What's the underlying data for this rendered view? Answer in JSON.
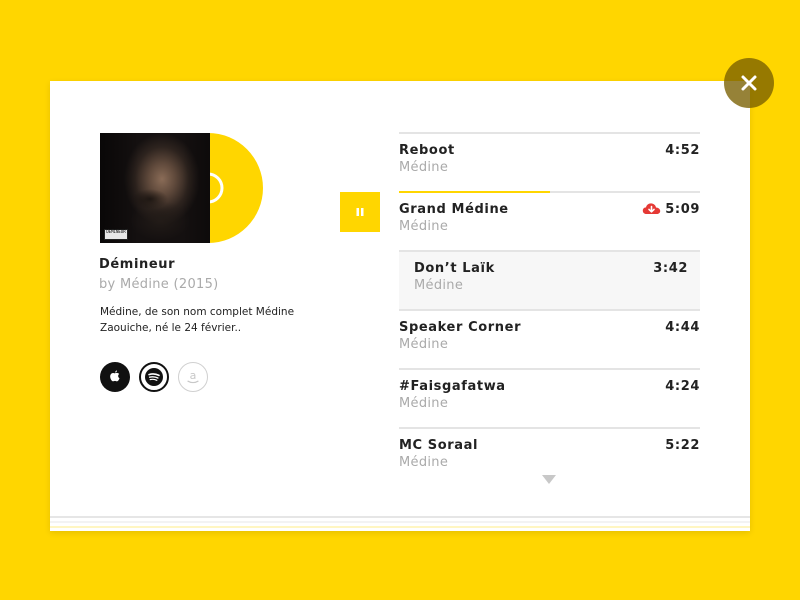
{
  "album": {
    "title": "Démineur",
    "byline": "by Médine (2015)",
    "description": "Médine, de son nom complet Médine Zaouiche, né le 24 février..",
    "cover_label": "DEMINEUR"
  },
  "stores": [
    {
      "name": "apple",
      "icon": "apple-icon"
    },
    {
      "name": "spotify",
      "icon": "spotify-icon"
    },
    {
      "name": "amazon",
      "icon": "amazon-icon",
      "glyph": "a"
    }
  ],
  "player": {
    "state": "playing",
    "current_track_progress": 0.5
  },
  "tracks": [
    {
      "title": "Reboot",
      "artist": "Médine",
      "duration": "4:52"
    },
    {
      "title": "Grand Médine",
      "artist": "Médine",
      "duration": "5:09",
      "cloud_icon": "cloud-download-icon"
    },
    {
      "title": "Don’t Laïk",
      "artist": "Médine",
      "duration": "3:42"
    },
    {
      "title": "Speaker Corner",
      "artist": "Médine",
      "duration": "4:44"
    },
    {
      "title": "#Faisgafatwa",
      "artist": "Médine",
      "duration": "4:24"
    },
    {
      "title": "MC Soraal",
      "artist": "Médine",
      "duration": "5:22"
    }
  ],
  "colors": {
    "accent": "#FFD600",
    "download": "#E53935"
  }
}
